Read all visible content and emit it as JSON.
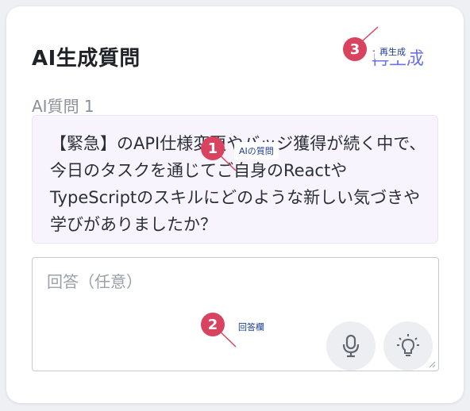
{
  "card": {
    "title": "AI生成質問",
    "regenerate_label": "再生成"
  },
  "question": {
    "label": "AI質問 1",
    "text": "【緊急】のAPI仕様変更やバッジ獲得が続く中で、今日のタスクを通じてご自身のReactやTypeScriptのスキルにどのような新しい気づきや学びがありましたか？"
  },
  "answer": {
    "placeholder": "回答（任意）",
    "value": ""
  },
  "icons": {
    "microphone": "microphone-icon",
    "lightbulb": "lightbulb-icon",
    "regenerate": "refresh-icon"
  },
  "annotations": [
    {
      "number": "1",
      "label": "AIの質問"
    },
    {
      "number": "2",
      "label": "回答欄"
    },
    {
      "number": "3",
      "label": "再生成"
    }
  ],
  "colors": {
    "accent": "#6b72e8",
    "badge": "#d8445f",
    "question_bg": "#f8f4fe"
  }
}
